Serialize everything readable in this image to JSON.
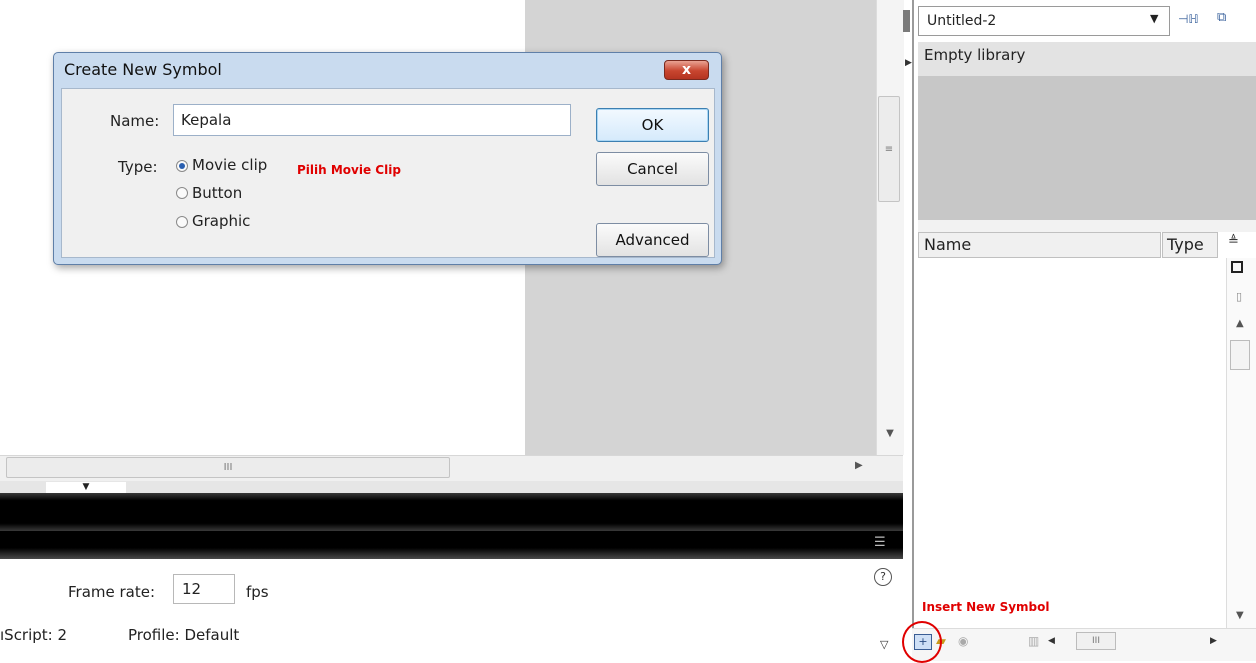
{
  "dialog": {
    "title": "Create New Symbol",
    "close_label": "x",
    "name_label": "Name:",
    "name_value": "Kepala",
    "type_label": "Type:",
    "types": [
      {
        "label": "Movie clip",
        "selected": true
      },
      {
        "label": "Button",
        "selected": false
      },
      {
        "label": "Graphic",
        "selected": false
      }
    ],
    "annotation": "Pilih Movie Clip",
    "ok_label": "OK",
    "cancel_label": "Cancel",
    "advanced_label": "Advanced"
  },
  "stage": {
    "hscroll_grip": "III",
    "vscroll_grip": "≡"
  },
  "properties": {
    "frame_rate_label": "Frame rate:",
    "frame_rate_value": "12",
    "frame_rate_unit": "fps",
    "actionscript_label": "ıScript:  2",
    "profile_label": "Profile:  Default"
  },
  "library": {
    "document_select": "Untitled-2",
    "header": "Empty library",
    "columns": [
      "Name",
      "Type"
    ],
    "annotation": "Insert New Symbol",
    "hscroll_grip": "III"
  },
  "colors": {
    "annotation_red": "#e00000",
    "dialog_frame": "#c9dbef",
    "stage_gray": "#d4d4d4"
  },
  "icons": [
    "pin-icon",
    "new-library-icon",
    "help-icon",
    "new-symbol-icon",
    "new-folder-icon",
    "properties-icon",
    "trash-icon",
    "panel-menu-icon"
  ]
}
